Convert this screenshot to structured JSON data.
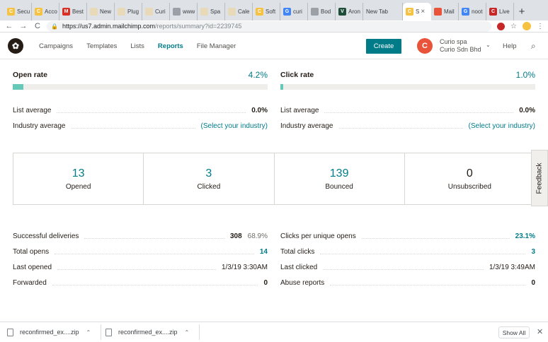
{
  "browser": {
    "tabs": [
      {
        "label": "Secu",
        "favicon": "C",
        "color": "#f5c242"
      },
      {
        "label": "Acco",
        "favicon": "C",
        "color": "#f5c242"
      },
      {
        "label": "Best",
        "favicon": "M",
        "color": "#d93025"
      },
      {
        "label": "New",
        "favicon": "",
        "color": "#e8d9b8"
      },
      {
        "label": "Plug",
        "favicon": "",
        "color": "#e8d9b8"
      },
      {
        "label": "Curi",
        "favicon": "",
        "color": "#e8d9b8"
      },
      {
        "label": "www",
        "favicon": "",
        "color": "#9aa0a6"
      },
      {
        "label": "Spa",
        "favicon": "",
        "color": "#e8d9b8"
      },
      {
        "label": "Cale",
        "favicon": "",
        "color": "#e8d9b8"
      },
      {
        "label": "Soft",
        "favicon": "C",
        "color": "#f5c242"
      },
      {
        "label": "curi",
        "favicon": "G",
        "color": "#4285f4"
      },
      {
        "label": "Bod",
        "favicon": "",
        "color": "#9aa0a6"
      },
      {
        "label": "Aron",
        "favicon": "V",
        "color": "#1e4d3a"
      },
      {
        "label": "New Tab",
        "favicon": "",
        "color": ""
      },
      {
        "label": "S",
        "favicon": "C",
        "color": "#f5c242",
        "active": true
      },
      {
        "label": "Mail",
        "favicon": "",
        "color": "#e8533a"
      },
      {
        "label": "noot",
        "favicon": "G",
        "color": "#4285f4"
      },
      {
        "label": "Live",
        "favicon": "C",
        "color": "#c62828"
      }
    ],
    "new_tab_glyph": "+",
    "url_host": "https://us7.admin.mailchimp.com",
    "url_path": "/reports/summary?id=2239745"
  },
  "nav": {
    "links": [
      "Campaigns",
      "Templates",
      "Lists",
      "Reports",
      "File Manager"
    ],
    "active": "Reports",
    "create": "Create",
    "avatar_letter": "C",
    "account_name": "Curio spa",
    "account_org": "Curio Sdn Bhd",
    "help": "Help"
  },
  "open_rate": {
    "title": "Open rate",
    "value": "4.2%",
    "fill": 0.042,
    "list_avg_label": "List average",
    "list_avg": "0.0%",
    "industry_label": "Industry average",
    "industry": "(Select your industry)"
  },
  "click_rate": {
    "title": "Click rate",
    "value": "1.0%",
    "fill": 0.01,
    "list_avg_label": "List average",
    "list_avg": "0.0%",
    "industry_label": "Industry average",
    "industry": "(Select your industry)"
  },
  "stats": [
    {
      "num": "13",
      "label": "Opened"
    },
    {
      "num": "3",
      "label": "Clicked"
    },
    {
      "num": "139",
      "label": "Bounced"
    },
    {
      "num": "0",
      "label": "Unsubscribed"
    }
  ],
  "feedback": "Feedback",
  "left_details": [
    {
      "label": "Successful deliveries",
      "value": "308",
      "extra": "68.9%"
    },
    {
      "label": "Total opens",
      "value": "14",
      "link": true
    },
    {
      "label": "Last opened",
      "value": "1/3/19 3:30AM",
      "plain": true
    },
    {
      "label": "Forwarded",
      "value": "0"
    }
  ],
  "right_details": [
    {
      "label": "Clicks per unique opens",
      "value": "23.1%",
      "link": true
    },
    {
      "label": "Total clicks",
      "value": "3",
      "link": true
    },
    {
      "label": "Last clicked",
      "value": "1/3/19 3:49AM",
      "plain": true
    },
    {
      "label": "Abuse reports",
      "value": "0"
    }
  ],
  "downloads": {
    "items": [
      "reconfirmed_ex....zip",
      "reconfirmed_ex....zip"
    ],
    "show_all": "Show All"
  }
}
